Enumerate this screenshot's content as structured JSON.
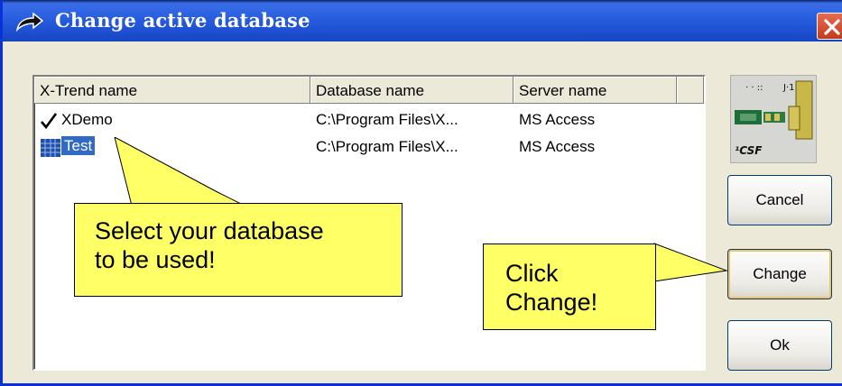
{
  "window": {
    "title": "Change active database",
    "colors": {
      "titlebar": "#1f52d4",
      "close": "#c43c1a",
      "selection": "#316ac5",
      "callout": "#ffff66"
    }
  },
  "list": {
    "columns": [
      "X-Trend name",
      "Database name",
      "Server name"
    ],
    "rows": [
      {
        "name": "XDemo",
        "database": "C:\\Program Files\\X...",
        "server": "MS Access",
        "icon": "check-icon",
        "selected": false
      },
      {
        "name": "Test",
        "database": "C:\\Program Files\\X...",
        "server": "MS Access",
        "icon": "database-grid-icon",
        "selected": true
      }
    ]
  },
  "logo": {
    "caption": "¹CSF"
  },
  "buttons": {
    "cancel": "Cancel",
    "change": "Change",
    "ok": "Ok"
  },
  "callouts": {
    "select": "Select your database\nto be used!",
    "change": "Click\nChange!"
  }
}
